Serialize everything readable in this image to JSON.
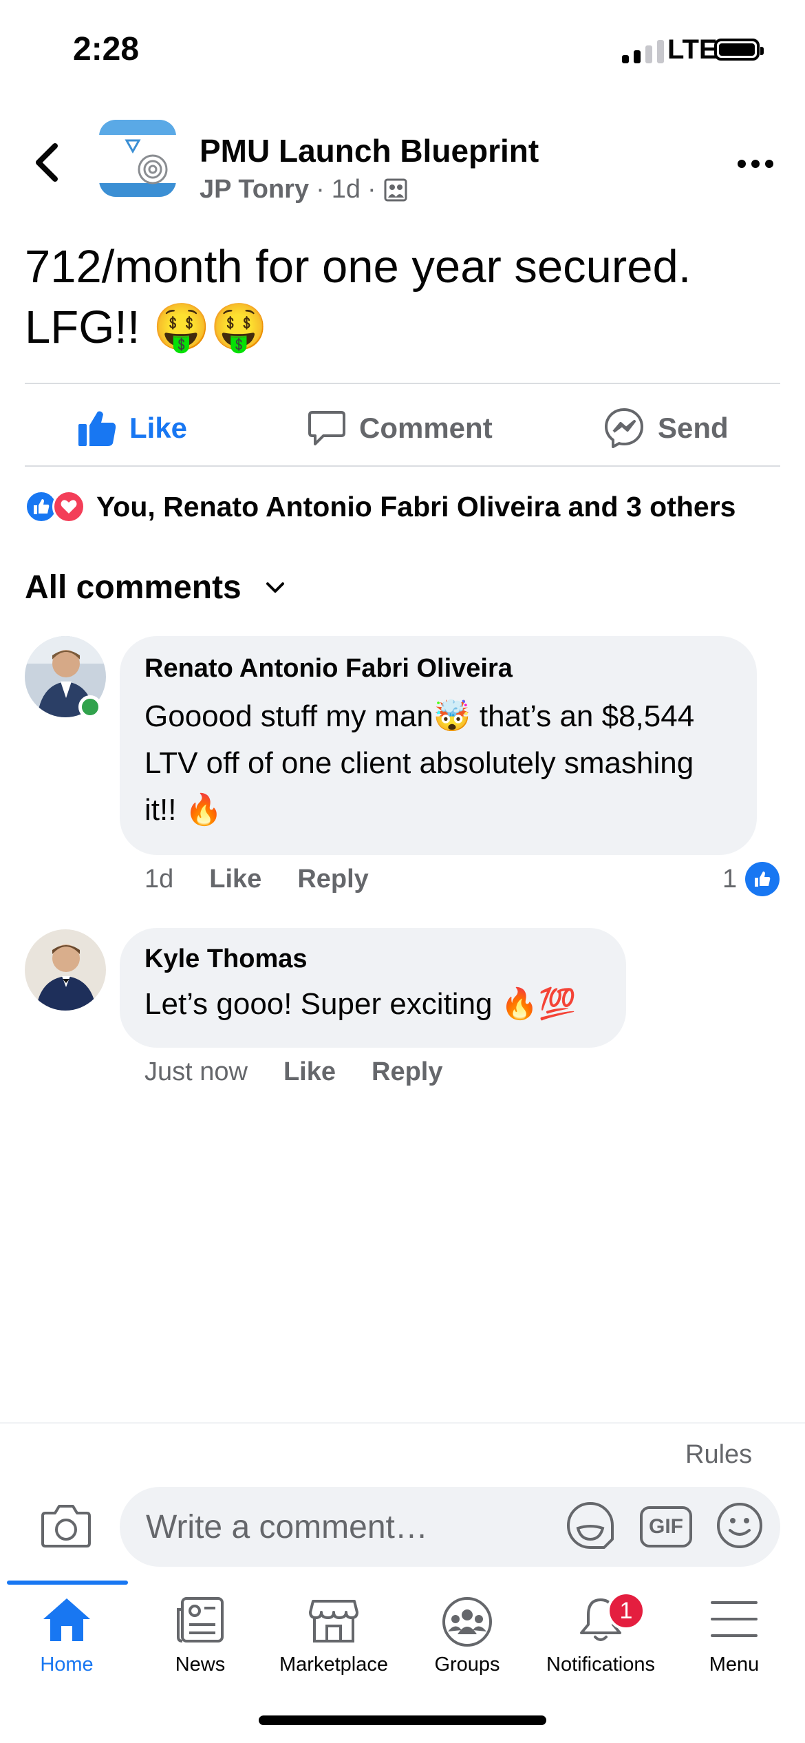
{
  "status_bar": {
    "time": "2:28",
    "network": "LTE"
  },
  "header": {
    "group_name": "PMU Launch Blueprint",
    "author": "JP Tonry",
    "time": "1d"
  },
  "post": {
    "text": "712/month for one year secured. LFG!! 🤑🤑"
  },
  "actions": {
    "like": "Like",
    "comment": "Comment",
    "send": "Send"
  },
  "reactions": {
    "summary": "You, Renato Antonio Fabri Oliveira and 3 others"
  },
  "comments_header": "All comments",
  "comments": [
    {
      "name": "Renato Antonio Fabri Oliveira",
      "text_line1": "Gooood stuff my man🤯 that’s an $8,544",
      "text_line2": "LTV off of one client absolutely smashing",
      "text_line3": "it!! 🔥",
      "time": "1d",
      "like": "Like",
      "reply": "Reply",
      "like_count": "1"
    },
    {
      "name": "Kyle Thomas",
      "text": "Let’s gooo! Super exciting 🔥💯",
      "time": "Just now",
      "like": "Like",
      "reply": "Reply"
    }
  ],
  "composer": {
    "rules": "Rules",
    "placeholder": "Write a comment…",
    "gif": "GIF"
  },
  "tabs": [
    {
      "label": "Home"
    },
    {
      "label": "News"
    },
    {
      "label": "Marketplace"
    },
    {
      "label": "Groups"
    },
    {
      "label": "Notifications",
      "badge": "1"
    },
    {
      "label": "Menu"
    }
  ],
  "colors": {
    "accent": "#1877f2",
    "badge": "#e41e3f",
    "bubble": "#f0f2f5",
    "secondary_text": "#65676b"
  }
}
